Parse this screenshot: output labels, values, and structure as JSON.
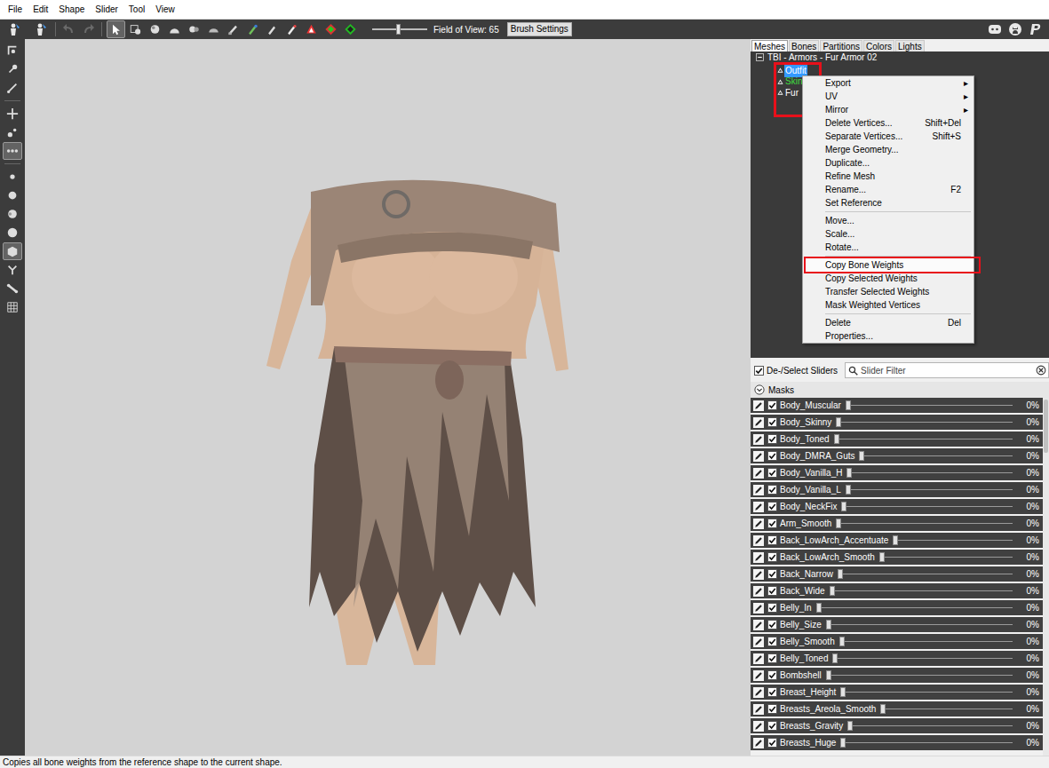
{
  "menu_bar": [
    {
      "label": "File"
    },
    {
      "label": "Edit"
    },
    {
      "label": "Shape"
    },
    {
      "label": "Slider"
    },
    {
      "label": "Tool"
    },
    {
      "label": "View"
    }
  ],
  "toolbar": {
    "app_buttons": [
      {
        "selected": false
      },
      {
        "selected": false
      }
    ],
    "history_buttons": [
      {
        "disabled": true
      },
      {
        "disabled": true
      }
    ],
    "tools": [
      {
        "selected": true
      },
      {
        "selected": false
      },
      {
        "selected": false
      },
      {
        "selected": false
      },
      {
        "selected": false
      },
      {
        "selected": false
      },
      {
        "selected": false
      },
      {
        "selected": false
      },
      {
        "selected": false
      },
      {
        "selected": false
      },
      {
        "selected": false
      },
      {
        "selected": false
      },
      {
        "selected": false
      }
    ],
    "fov": {
      "label": "Field of View: 65",
      "level": 0.47
    },
    "brush_settings": "Brush Settings",
    "links": [
      {
        "kind": "discord"
      },
      {
        "kind": "github"
      },
      {
        "kind": "paypal"
      }
    ]
  },
  "left_tools": [
    {
      "selected": false
    },
    {
      "selected": false
    },
    {
      "selected": false
    },
    {
      "selected": false
    },
    {
      "selected": false
    },
    {
      "selected": true
    },
    {
      "selected": false
    },
    {
      "selected": false
    },
    {
      "selected": false
    },
    {
      "selected": false
    },
    {
      "selected": true
    },
    {
      "selected": false
    },
    {
      "selected": false
    },
    {
      "selected": false
    }
  ],
  "panel_tabs": [
    {
      "label": "Meshes",
      "selected": true
    },
    {
      "label": "Bones",
      "selected": false
    },
    {
      "label": "Partitions",
      "selected": false
    },
    {
      "label": "Colors",
      "selected": false
    },
    {
      "label": "Lights",
      "selected": false
    }
  ],
  "mesh_tree": {
    "root": {
      "label": "TBI - Armors - Fur Armor 02",
      "expanded": true
    },
    "items": [
      {
        "label": "Outfit",
        "selected": true,
        "color": "#ffffff"
      },
      {
        "label": "Skin",
        "selected": false,
        "color": "#3fdc3f"
      },
      {
        "label": "Fur",
        "selected": false,
        "color": "#ffffff"
      }
    ]
  },
  "context_menu": {
    "items": [
      {
        "kind": "item",
        "label": "Export",
        "arrow": "▸",
        "selected": false
      },
      {
        "kind": "item",
        "label": "UV",
        "arrow": "▸",
        "selected": false
      },
      {
        "kind": "item",
        "label": "Mirror",
        "arrow": "▸",
        "selected": false
      },
      {
        "kind": "item",
        "label": "Delete Vertices...",
        "shortcut": "Shift+Del",
        "selected": false
      },
      {
        "kind": "item",
        "label": "Separate Vertices...",
        "shortcut": "Shift+S",
        "selected": false
      },
      {
        "kind": "item",
        "label": "Merge Geometry...",
        "selected": false
      },
      {
        "kind": "item",
        "label": "Duplicate...",
        "selected": false
      },
      {
        "kind": "item",
        "label": "Refine Mesh",
        "selected": false
      },
      {
        "kind": "item",
        "label": "Rename...",
        "shortcut": "F2",
        "selected": false
      },
      {
        "kind": "item",
        "label": "Set Reference",
        "selected": false
      },
      {
        "kind": "separator"
      },
      {
        "kind": "item",
        "label": "Move...",
        "selected": false
      },
      {
        "kind": "item",
        "label": "Scale...",
        "selected": false
      },
      {
        "kind": "item",
        "label": "Rotate...",
        "selected": false
      },
      {
        "kind": "separator"
      },
      {
        "kind": "item",
        "label": "Copy Bone Weights",
        "selected": true
      },
      {
        "kind": "item",
        "label": "Copy Selected Weights",
        "selected": false
      },
      {
        "kind": "item",
        "label": "Transfer Selected Weights",
        "selected": false
      },
      {
        "kind": "item",
        "label": "Mask Weighted Vertices",
        "selected": false
      },
      {
        "kind": "separator"
      },
      {
        "kind": "item",
        "label": "Delete",
        "shortcut": "Del",
        "selected": false
      },
      {
        "kind": "item",
        "label": "Properties...",
        "selected": false
      }
    ]
  },
  "slider_panel": {
    "select_all": {
      "label": "De-/Select Sliders",
      "checked": true
    },
    "filter": {
      "placeholder": "Slider Filter"
    },
    "masks": {
      "label": "Masks",
      "expanded": true
    }
  },
  "sliders": [
    {
      "name": "Body_Muscular",
      "checked": true,
      "level": 0,
      "reading": "0%"
    },
    {
      "name": "Body_Skinny",
      "checked": true,
      "level": 0,
      "reading": "0%"
    },
    {
      "name": "Body_Toned",
      "checked": true,
      "level": 0,
      "reading": "0%"
    },
    {
      "name": "Body_DMRA_Guts",
      "checked": true,
      "level": 0,
      "reading": "0%"
    },
    {
      "name": "Body_Vanilla_H",
      "checked": true,
      "level": 0,
      "reading": "0%"
    },
    {
      "name": "Body_Vanilla_L",
      "checked": true,
      "level": 0,
      "reading": "0%"
    },
    {
      "name": "Body_NeckFix",
      "checked": true,
      "level": 0,
      "reading": "0%"
    },
    {
      "name": "Arm_Smooth",
      "checked": true,
      "level": 0,
      "reading": "0%"
    },
    {
      "name": "Back_LowArch_Accentuate",
      "checked": true,
      "level": 0,
      "reading": "0%"
    },
    {
      "name": "Back_LowArch_Smooth",
      "checked": true,
      "level": 0,
      "reading": "0%"
    },
    {
      "name": "Back_Narrow",
      "checked": true,
      "level": 0,
      "reading": "0%"
    },
    {
      "name": "Back_Wide",
      "checked": true,
      "level": 0,
      "reading": "0%"
    },
    {
      "name": "Belly_In",
      "checked": true,
      "level": 0,
      "reading": "0%"
    },
    {
      "name": "Belly_Size",
      "checked": true,
      "level": 0,
      "reading": "0%"
    },
    {
      "name": "Belly_Smooth",
      "checked": true,
      "level": 0,
      "reading": "0%"
    },
    {
      "name": "Belly_Toned",
      "checked": true,
      "level": 0,
      "reading": "0%"
    },
    {
      "name": "Bombshell",
      "checked": true,
      "level": 0,
      "reading": "0%"
    },
    {
      "name": "Breast_Height",
      "checked": true,
      "level": 0,
      "reading": "0%"
    },
    {
      "name": "Breasts_Areola_Smooth",
      "checked": true,
      "level": 0,
      "reading": "0%"
    },
    {
      "name": "Breasts_Gravity",
      "checked": true,
      "level": 0,
      "reading": "0%"
    },
    {
      "name": "Breasts_Huge",
      "checked": true,
      "level": 0,
      "reading": "0%"
    }
  ],
  "status_bar": {
    "text": "Copies all bone weights from the reference shape to the current shape."
  }
}
